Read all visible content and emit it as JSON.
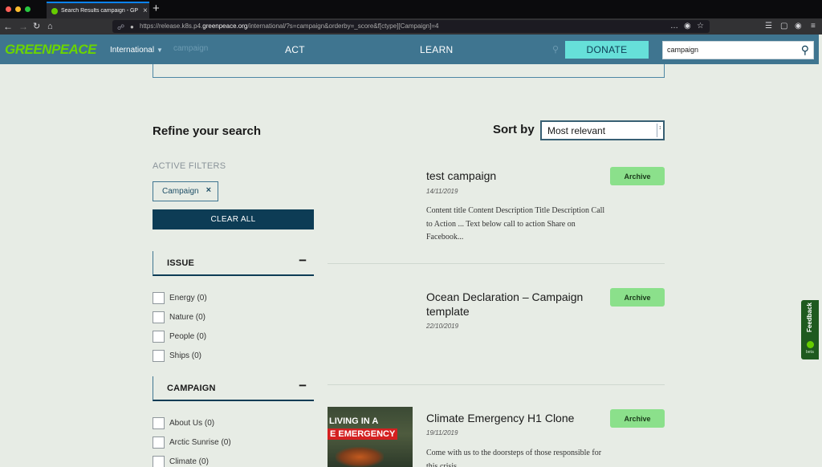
{
  "browser": {
    "tab_title": "Search Results campaign - GP",
    "url_prefix": "https://release.k8s.p4.",
    "url_domain": "greenpeace.org",
    "url_suffix": "/international/?s=campaign&orderby=_score&f[ctype][Campaign]=4",
    "more_icon": "…"
  },
  "header": {
    "logo": "GREENPEACE",
    "country": "International",
    "search_ghost": "campaign",
    "nav": [
      "ACT",
      "LEARN"
    ],
    "donate": "DONATE",
    "search_value": "campaign"
  },
  "sidebar": {
    "refine_title": "Refine your search",
    "active_filters_label": "ACTIVE FILTERS",
    "active_filter_chip": "Campaign",
    "clear_all": "CLEAR ALL",
    "facets": [
      {
        "title": "ISSUE",
        "items": [
          "Energy (0)",
          "Nature (0)",
          "People (0)",
          "Ships (0)"
        ]
      },
      {
        "title": "CAMPAIGN",
        "items": [
          "About Us (0)",
          "Arctic Sunrise (0)",
          "Climate (0)"
        ]
      }
    ]
  },
  "sort": {
    "label": "Sort by",
    "selected": "Most relevant"
  },
  "results": [
    {
      "title": "test campaign",
      "date": "14/11/2019",
      "badge": "Archive",
      "excerpt": "Content title Content Description Title Description Call to Action ... Text below call to action Share on Facebook..."
    },
    {
      "title": "Ocean Declaration – Campaign template",
      "date": "22/10/2019",
      "badge": "Archive",
      "excerpt": ""
    },
    {
      "title": "Climate Emergency H1 Clone",
      "date": "19/11/2019",
      "badge": "Archive",
      "excerpt": "Come with us to the doorsteps of those responsible for this crisis",
      "thumb_line1": "LIVING IN A",
      "thumb_line2": "E EMERGENCY"
    }
  ],
  "feedback": {
    "label": "Feedback",
    "beta": "beta"
  },
  "colors": {
    "nav_blue": "#3f7590",
    "dark_blue": "#0d3c55",
    "donate": "#66e0d9",
    "archive_badge": "#8be08b",
    "logo_green": "#6bd400"
  }
}
